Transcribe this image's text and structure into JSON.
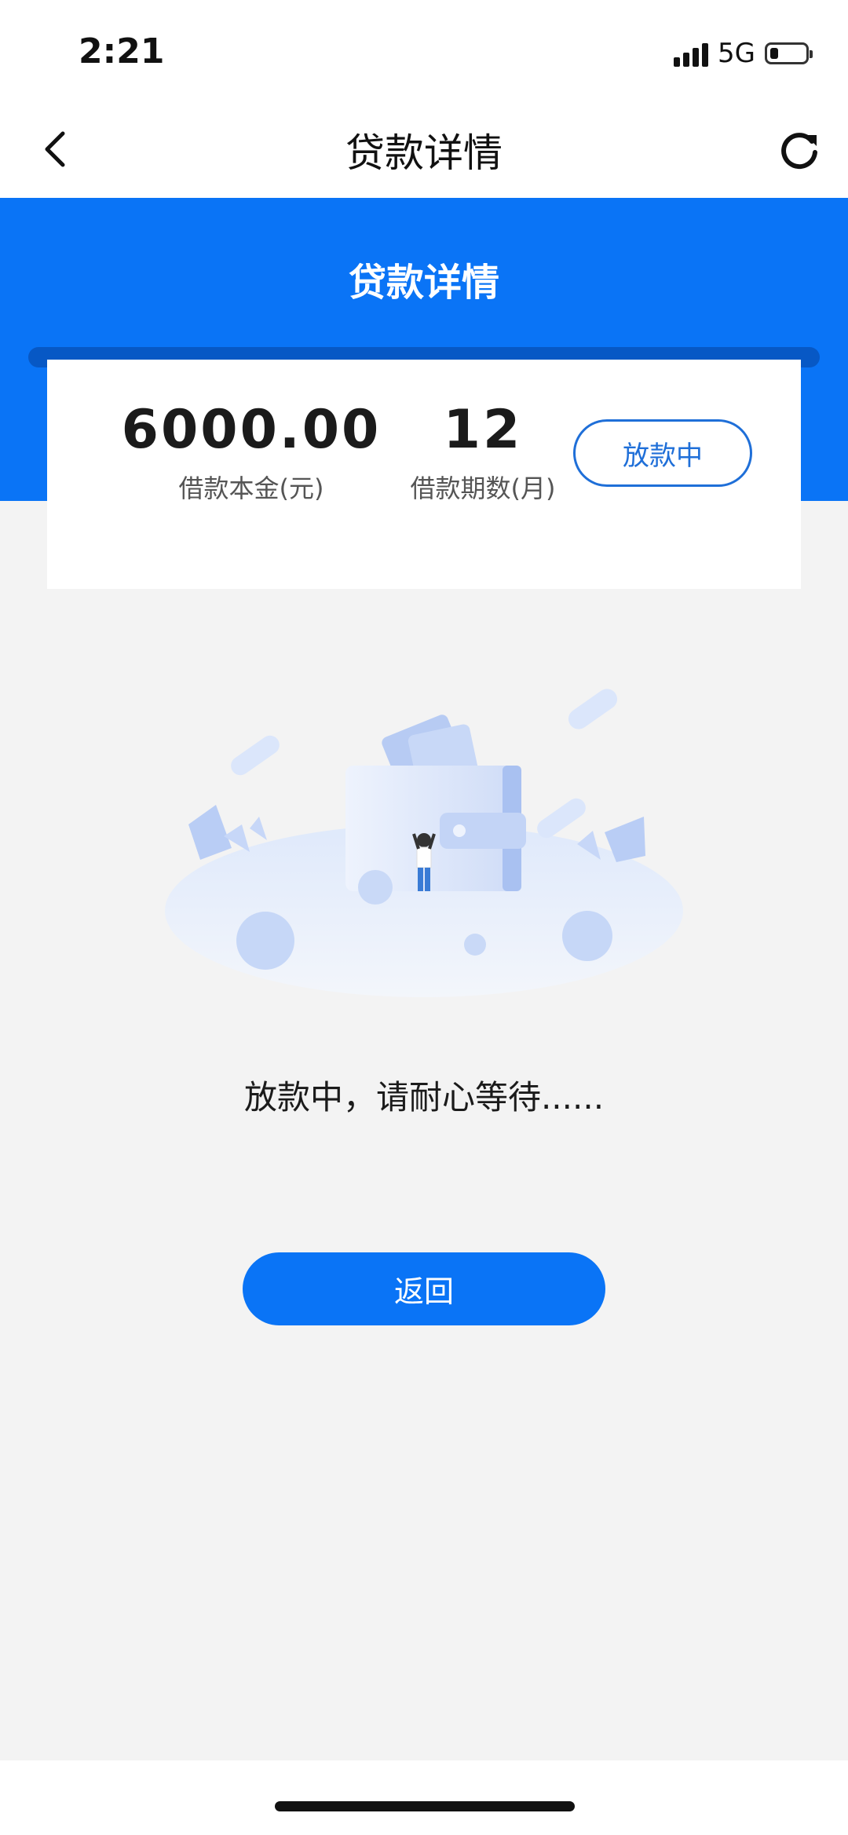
{
  "status_bar": {
    "time": "2:21",
    "network": "5G",
    "icons": [
      "signal-icon",
      "battery-icon"
    ]
  },
  "nav": {
    "title": "贷款详情",
    "back_icon": "chevron-left-icon",
    "refresh_icon": "refresh-icon"
  },
  "header": {
    "title": "贷款详情",
    "color": "#0a74f6"
  },
  "loan_card": {
    "amount_value": "6000.00",
    "amount_label": "借款本金(元)",
    "term_value": "12",
    "term_label": "借款期数(月)",
    "status_label": "放款中",
    "status_color": "#1f6fd8"
  },
  "illustration": {
    "icon": "wallet-illustration"
  },
  "message": "放款中，请耐心等待......",
  "return_button": {
    "label": "返回",
    "color": "#0a74f6"
  }
}
